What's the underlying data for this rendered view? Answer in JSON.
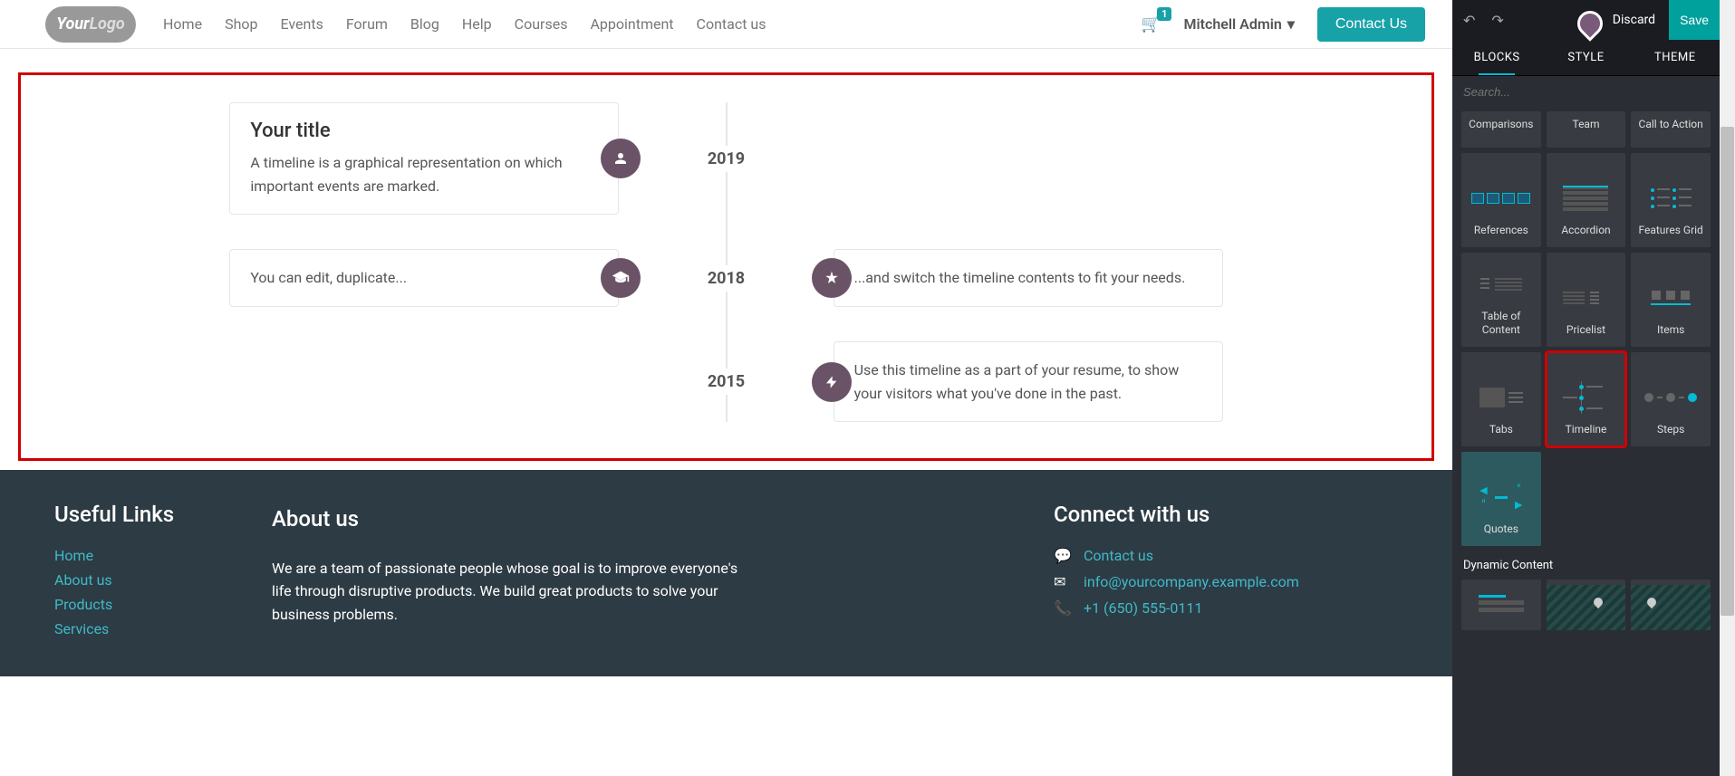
{
  "header": {
    "logo_text1": "Your",
    "logo_text2": "Logo",
    "nav": [
      "Home",
      "Shop",
      "Events",
      "Forum",
      "Blog",
      "Help",
      "Courses",
      "Appointment",
      "Contact us"
    ],
    "cart_count": "1",
    "user_name": "Mitchell Admin",
    "contact_btn": "Contact Us"
  },
  "timeline": {
    "items": [
      {
        "year": "2019",
        "title": "Your title",
        "desc": "A timeline is a graphical representation on which important events are marked.",
        "side": "left",
        "icon": "person"
      },
      {
        "year": "2018",
        "left_text": "You can edit, duplicate...",
        "right_text": "...and switch the timeline contents to fit your needs.",
        "icon_left": "graduation",
        "icon_right": "star"
      },
      {
        "year": "2015",
        "right_text": "Use this timeline as a part of your resume, to show your visitors what you've done in the past.",
        "icon_right": "bolt"
      }
    ]
  },
  "footer": {
    "useful_title": "Useful Links",
    "links": [
      "Home",
      "About us",
      "Products",
      "Services"
    ],
    "about_title": "About us",
    "about_text": "We are a team of passionate people whose goal is to improve everyone's life through disruptive products. We build great products to solve your business problems.",
    "connect_title": "Connect with us",
    "contact_link": "Contact us",
    "email": "info@yourcompany.example.com",
    "phone": "+1 (650) 555-0111"
  },
  "sidebar": {
    "discard": "Discard",
    "save": "Save",
    "tabs": [
      "BLOCKS",
      "STYLE",
      "THEME"
    ],
    "search_placeholder": "Search...",
    "dynamic_label": "Dynamic Content",
    "blocks_row1": [
      "Comparisons",
      "Team",
      "Call to Action"
    ],
    "blocks_row2": [
      "References",
      "Accordion",
      "Features Grid"
    ],
    "blocks_row3": [
      "Table of Content",
      "Pricelist",
      "Items"
    ],
    "blocks_row4": [
      "Tabs",
      "Timeline",
      "Steps"
    ],
    "blocks_row5": [
      "Quotes"
    ]
  }
}
